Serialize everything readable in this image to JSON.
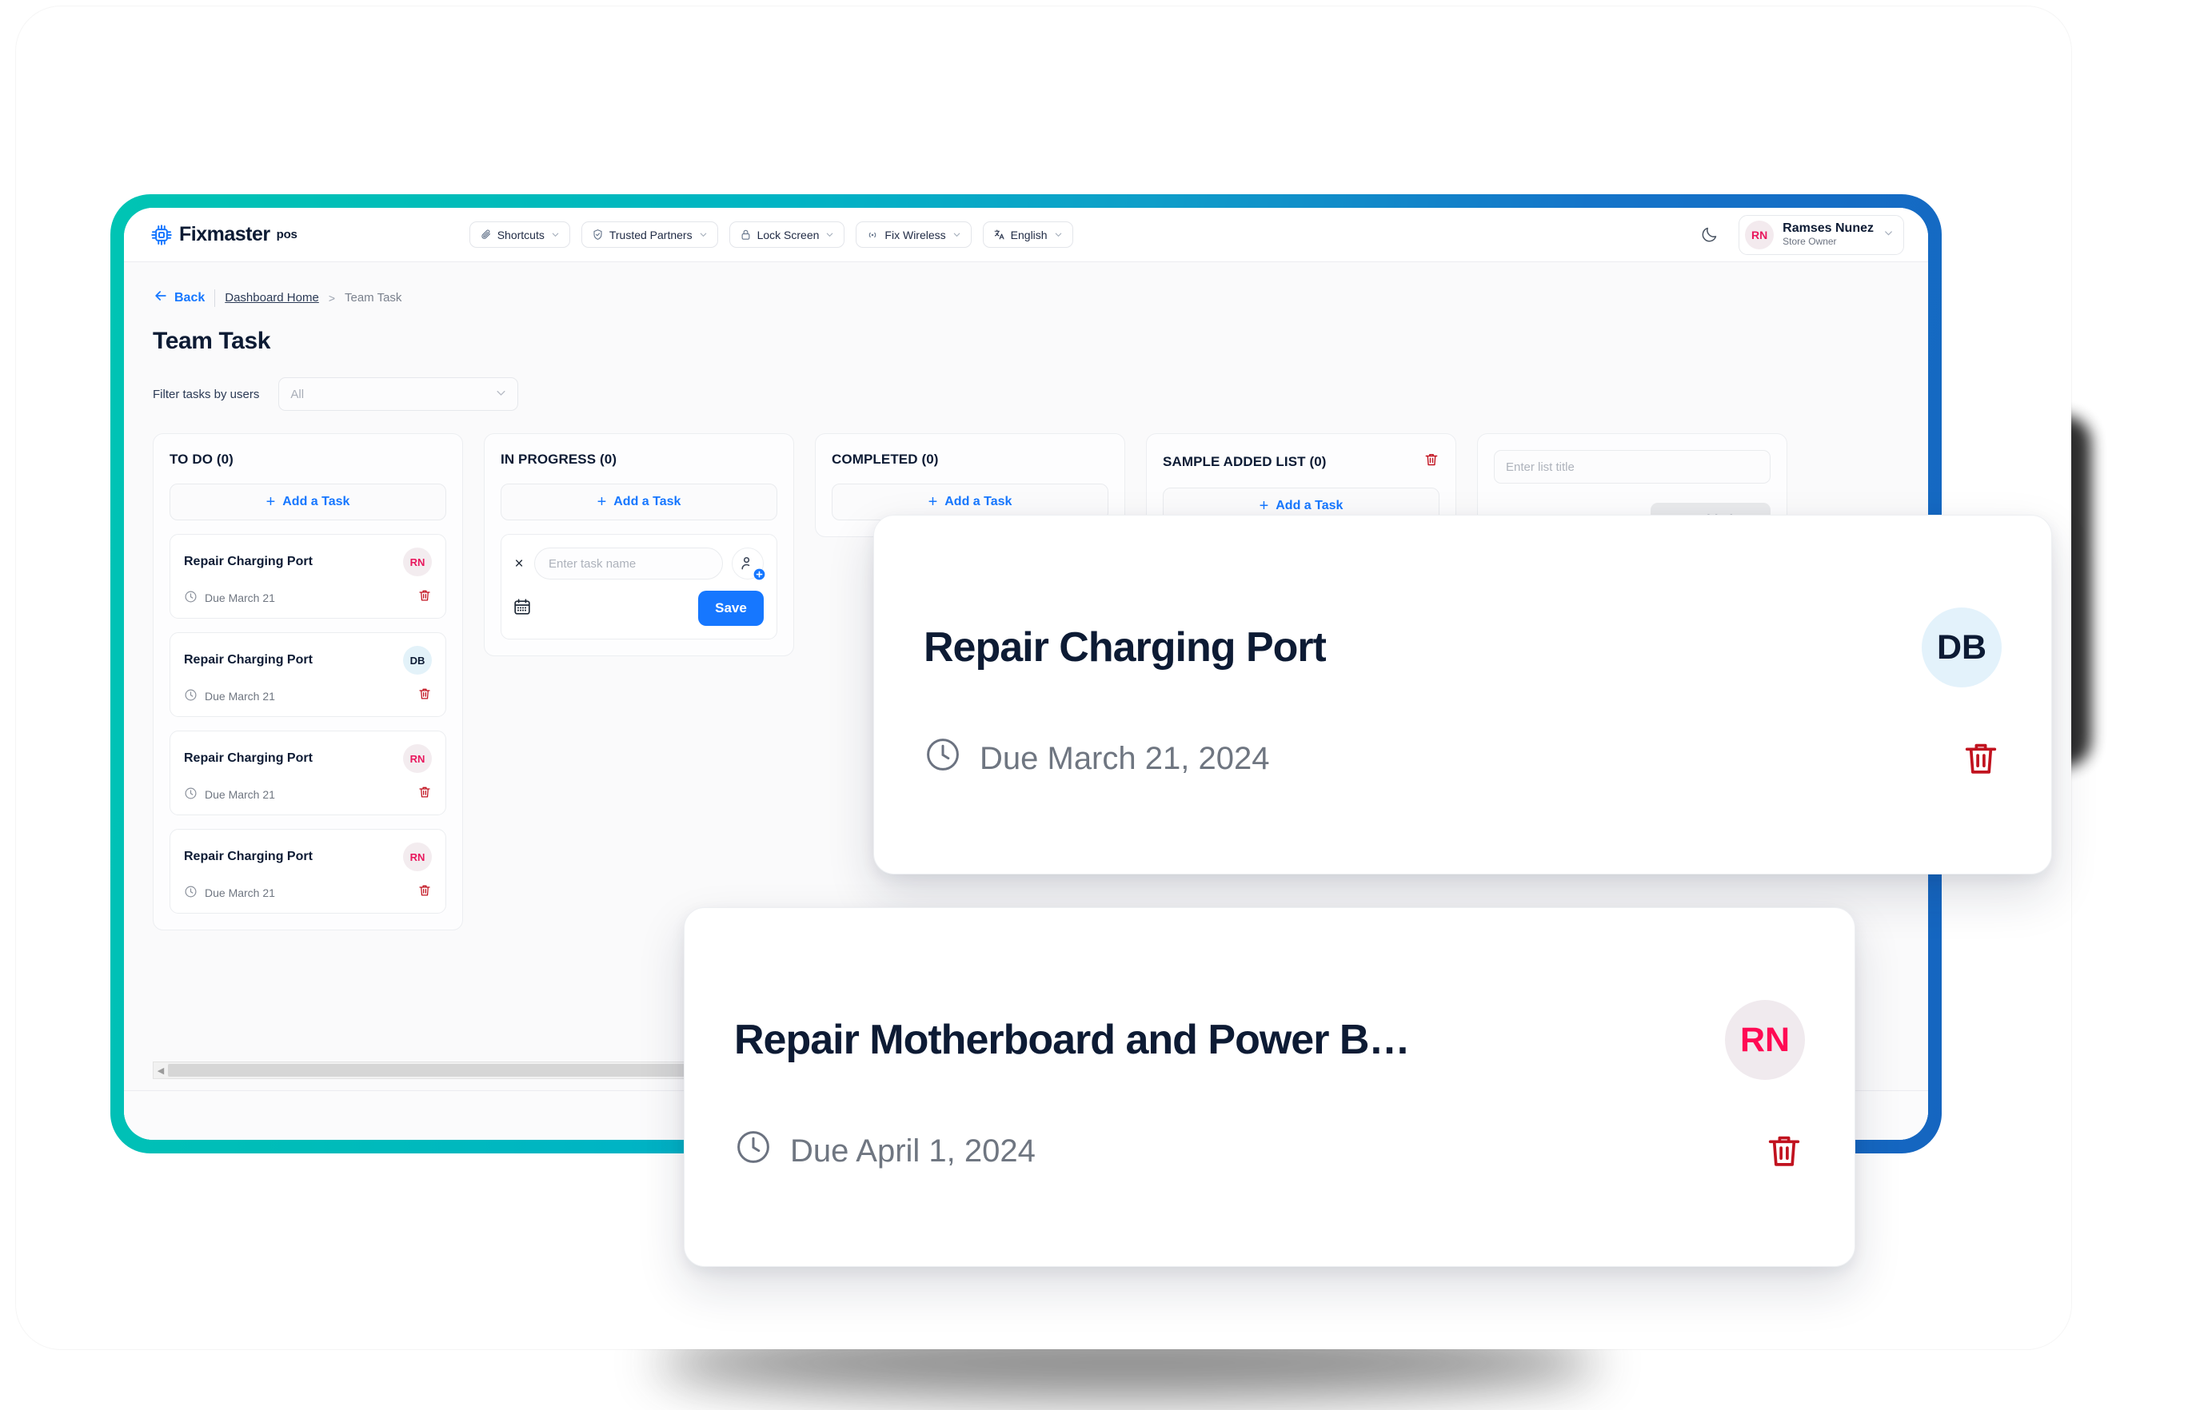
{
  "brand": {
    "name": "Fixmaster",
    "suffix": "pos",
    "icon": "cpu-chip-icon"
  },
  "topnav": {
    "pills": [
      {
        "label": "Shortcuts",
        "icon": "paperclip-icon"
      },
      {
        "label": "Trusted Partners",
        "icon": "shield-check-icon"
      },
      {
        "label": "Lock Screen",
        "icon": "lock-icon"
      },
      {
        "label": "Fix Wireless",
        "icon": "wireless-icon"
      },
      {
        "label": "English",
        "icon": "translate-icon"
      }
    ],
    "theme_toggle_icon": "moon-icon",
    "user": {
      "initials": "RN",
      "name": "Ramses Nunez",
      "role": "Store Owner"
    }
  },
  "breadcrumb": {
    "back_label": "Back",
    "home_label": "Dashboard Home",
    "separator": ">",
    "current_label": "Team Task"
  },
  "page": {
    "title": "Team Task"
  },
  "filter": {
    "label": "Filter tasks by users",
    "value": "All",
    "placeholder": "All"
  },
  "board": {
    "add_task_label": "Add a Task",
    "columns": [
      {
        "title": "TO DO (0)",
        "deletable": false,
        "tasks": [
          {
            "name": "Repair Charging Port",
            "due": "Due March 21",
            "initials": "RN",
            "avatar_style": "rn"
          },
          {
            "name": "Repair Charging Port",
            "due": "Due March 21",
            "initials": "DB",
            "avatar_style": "db"
          },
          {
            "name": "Repair Charging Port",
            "due": "Due March 21",
            "initials": "RN",
            "avatar_style": "rn"
          },
          {
            "name": "Repair Charging Port",
            "due": "Due March 21",
            "initials": "RN",
            "avatar_style": "rn"
          }
        ]
      },
      {
        "title": "IN PROGRESS (0)",
        "deletable": false,
        "tasks": [],
        "new_task_form": {
          "close_label": "×",
          "name_placeholder": "Enter task name",
          "assign_icon": "user-add-icon",
          "date_icon": "calendar-icon",
          "save_label": "Save"
        }
      },
      {
        "title": "COMPLETED (0)",
        "deletable": false,
        "tasks": []
      },
      {
        "title": "SAMPLE ADDED LIST (0)",
        "deletable": true,
        "tasks": []
      }
    ],
    "add_list": {
      "placeholder": "Enter list title",
      "button_label": "Add List"
    }
  },
  "footer": {
    "home_icon": "home-icon"
  },
  "popups": [
    {
      "id": "charging",
      "title": "Repair Charging Port",
      "due": "Due March 21, 2024",
      "initials": "DB",
      "avatar_style": "db",
      "clock_icon": "clock-icon",
      "delete_icon": "trash-icon"
    },
    {
      "id": "motherboard",
      "title": "Repair Motherboard and Power B…",
      "due": "Due April 1, 2024",
      "initials": "RN",
      "avatar_style": "rn",
      "clock_icon": "clock-icon",
      "delete_icon": "trash-icon"
    }
  ],
  "colors": {
    "accent_blue": "#1677ff",
    "frame_start": "#00c4b4",
    "frame_end": "#1565c0",
    "danger_red": "#c1121f",
    "avatar_pink": "#e8175d",
    "title_navy": "#0d1b34"
  }
}
